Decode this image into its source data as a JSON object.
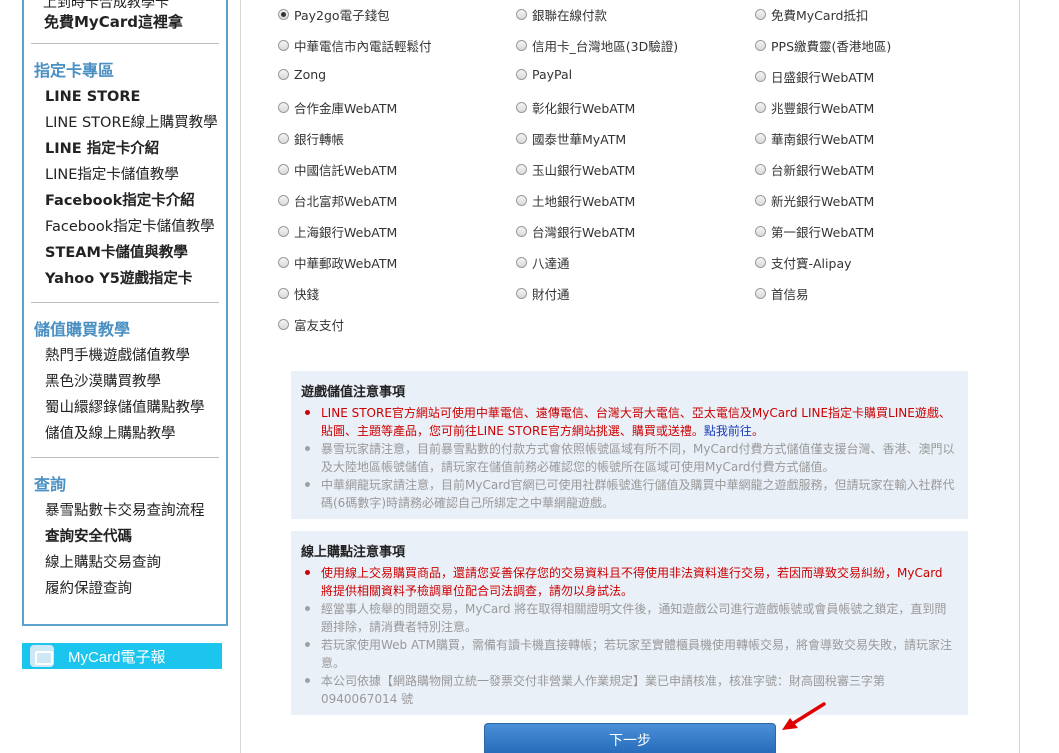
{
  "sidebar": {
    "top_cut": "上到時卡合成教學卡",
    "promo": "免費MyCard這裡拿",
    "sections": [
      {
        "heading": "指定卡專區",
        "items": [
          {
            "label": "LINE STORE",
            "bold": true
          },
          {
            "label": "LINE STORE線上購買教學",
            "bold": false
          },
          {
            "label": "LINE 指定卡介紹",
            "bold": true
          },
          {
            "label": "LINE指定卡儲值教學",
            "bold": false
          },
          {
            "label": "Facebook指定卡介紹",
            "bold": true
          },
          {
            "label": "Facebook指定卡儲值教學",
            "bold": false
          },
          {
            "label": "STEAM卡儲值與教學",
            "bold": true
          },
          {
            "label": "Yahoo Y5遊戲指定卡",
            "bold": true
          }
        ]
      },
      {
        "heading": "儲值購買教學",
        "items": [
          {
            "label": "熱門手機遊戲儲值教學",
            "bold": false
          },
          {
            "label": "黑色沙漠購買教學",
            "bold": false
          },
          {
            "label": "蜀山繯繆錄儲值購點教學",
            "bold": false
          },
          {
            "label": "儲值及線上購點教學",
            "bold": false
          }
        ]
      },
      {
        "heading": "查詢",
        "items": [
          {
            "label": "暴雪點數卡交易查詢流程",
            "bold": false
          },
          {
            "label": "查詢安全代碼",
            "bold": true
          },
          {
            "label": "線上購點交易查詢",
            "bold": false
          },
          {
            "label": "履約保證查詢",
            "bold": false
          }
        ]
      }
    ],
    "newsletter": "MyCard電子報"
  },
  "payment_options": [
    [
      "Pay2go電子錢包",
      "銀聯在線付款",
      "免費MyCard抵扣"
    ],
    [
      "中華電信市內電話輕鬆付",
      "信用卡_台灣地區(3D驗證)",
      "PPS繳費靈(香港地區)"
    ],
    [
      "Zong",
      "PayPal",
      "日盛銀行WebATM"
    ],
    [
      "合作金庫WebATM",
      "彰化銀行WebATM",
      "兆豐銀行WebATM"
    ],
    [
      "銀行轉帳",
      "國泰世華MyATM",
      "華南銀行WebATM"
    ],
    [
      "中國信託WebATM",
      "玉山銀行WebATM",
      "台新銀行WebATM"
    ],
    [
      "台北富邦WebATM",
      "土地銀行WebATM",
      "新光銀行WebATM"
    ],
    [
      "上海銀行WebATM",
      "台灣銀行WebATM",
      "第一銀行WebATM"
    ],
    [
      "中華郵政WebATM",
      "八達通",
      "支付寶-Alipay"
    ],
    [
      "快錢",
      "財付通",
      "首信易"
    ],
    [
      "富友支付"
    ]
  ],
  "selected_option": "Pay2go電子錢包",
  "notice_game": {
    "title": "遊戲儲值注意事項",
    "items": [
      {
        "text": "LINE STORE官方網站可使用中華電信、遠傳電信、台灣大哥大電信、亞太電信及MyCard LINE指定卡購買LINE遊戲、貼圖、主題等產品，您可前往LINE STORE官方網站挑選、購買或送禮。",
        "link": "點我前往",
        "tail": "。",
        "red": true
      },
      {
        "text": "暴雪玩家請注意，目前暴雪點數的付款方式會依照帳號區域有所不同，MyCard付費方式儲值僅支援台灣、香港、澳門以及大陸地區帳號儲值，請玩家在儲值前務必確認您的帳號所在區域可使用MyCard付費方式儲值。",
        "red": false
      },
      {
        "text": "中華網龍玩家請注意，目前MyCard官網已可使用社群帳號進行儲值及購買中華網龍之遊戲服務，但請玩家在輸入社群代碼(6碼數字)時請務必確認自己所綁定之中華網龍遊戲。",
        "red": false
      }
    ]
  },
  "notice_buy": {
    "title": "線上購點注意事項",
    "items": [
      {
        "text": "使用線上交易購買商品，還請您妥善保存您的交易資料且不得使用非法資料進行交易，若因而導致交易糾紛，MyCard 將提供相關資料予檢調單位配合司法調查，請勿以身試法。",
        "red": true
      },
      {
        "text": "經當事人檢舉的問題交易，MyCard 將在取得相關證明文件後，通知遊戲公司進行遊戲帳號或會員帳號之鎖定，直到問題排除，請消費者特別注意。",
        "red": false
      },
      {
        "text": "若玩家使用Web ATM購買，需備有讀卡機直接轉帳；若玩家至實體櫃員機使用轉帳交易，將會導致交易失敗，請玩家注意。",
        "red": false
      },
      {
        "text": "本公司依據【網路購物開立統一發票交付非營業人作業規定】業已申請核准，核准字號：財高國稅審三字第0940067014 號",
        "red": false
      }
    ]
  },
  "next_button": "下一步",
  "colors": {
    "sidebar_border": "#5aa3cf",
    "accent_blue": "#4a90c2",
    "warning_red": "#cc0000",
    "notice_bg": "#eaf0f8",
    "button_blue": "#2369b8",
    "arrow_red": "#e00000"
  }
}
